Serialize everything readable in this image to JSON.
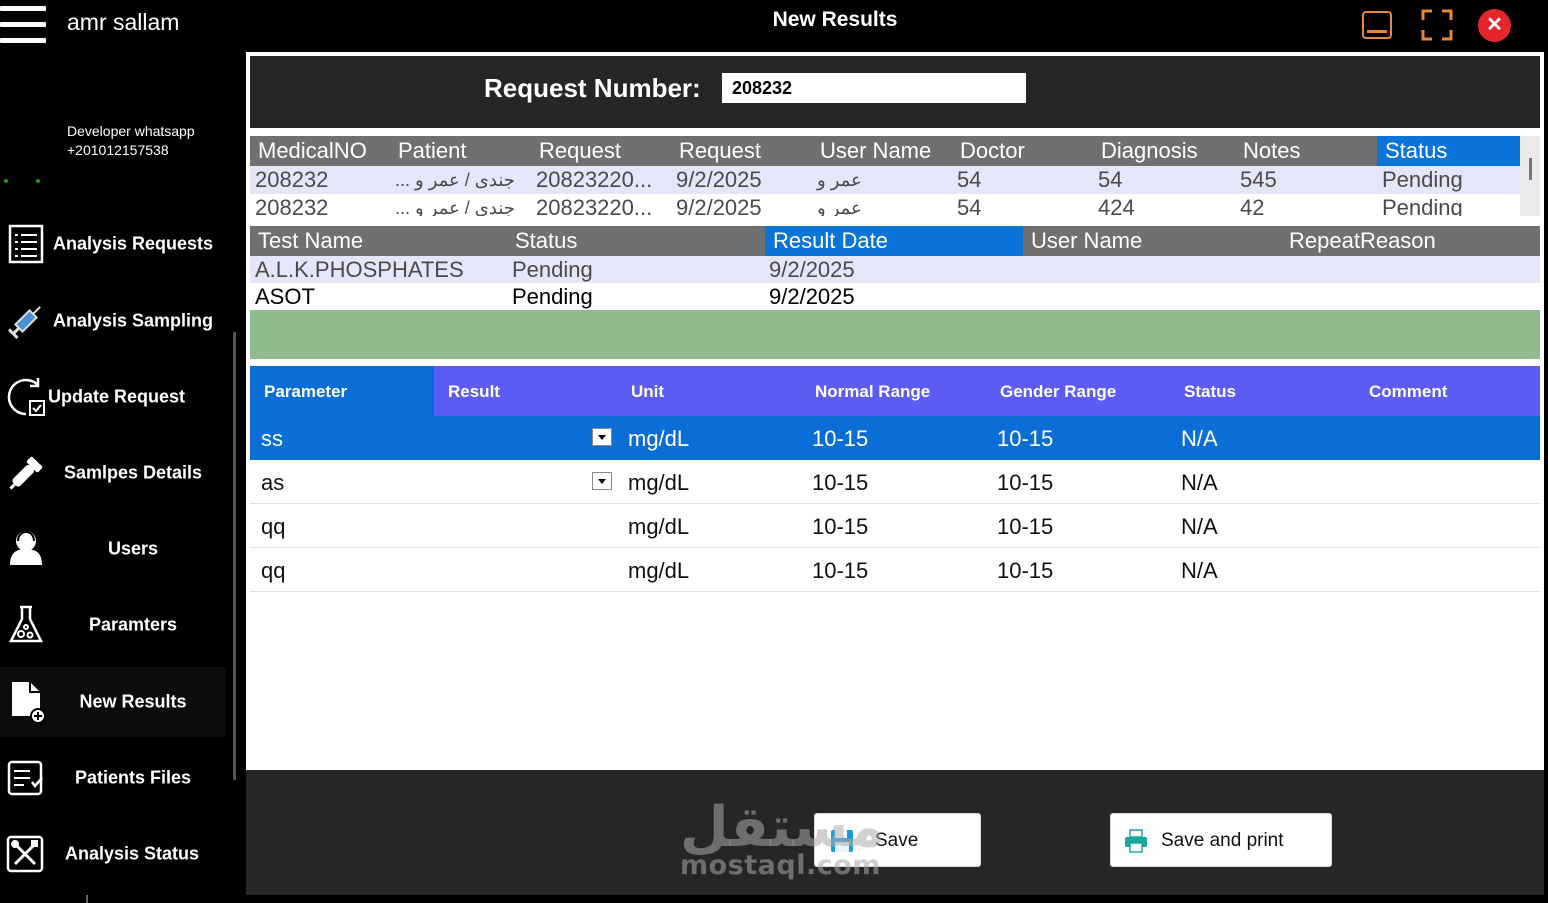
{
  "window": {
    "title": "New Results",
    "user": "amr sallam",
    "close_glyph": "✕"
  },
  "developer": {
    "line1": "Developer whatsapp",
    "line2": "+201012157538"
  },
  "sidebar": {
    "items": [
      {
        "label": "Analysis Requests",
        "icon": "list-icon"
      },
      {
        "label": "Analysis Sampling",
        "icon": "syringe-icon"
      },
      {
        "label": "Update Request",
        "icon": "refresh-check-icon"
      },
      {
        "label": "Samlpes Details",
        "icon": "dropper-icon"
      },
      {
        "label": "Users",
        "icon": "users-icon"
      },
      {
        "label": "Paramters",
        "icon": "flask-icon"
      },
      {
        "label": "New Results",
        "icon": "document-add-icon"
      },
      {
        "label": "Patients Files",
        "icon": "checklist-icon"
      },
      {
        "label": "Analysis Status",
        "icon": "tools-icon"
      }
    ]
  },
  "request": {
    "label": "Request Number:",
    "value": "208232"
  },
  "requests_grid": {
    "columns": [
      "MedicalNO",
      "Patient",
      "Request",
      "Request",
      "User Name",
      "Doctor",
      "Diagnosis",
      "Notes",
      "Status"
    ],
    "rows": [
      [
        "208232",
        "... جندى / عمر و",
        "20823220...",
        "9/2/2025",
        "عمر و",
        "54",
        "54",
        "545",
        "Pending"
      ],
      [
        "208232",
        "... جندى / عمر و",
        "20823220...",
        "9/2/2025",
        "عمر و",
        "54",
        "424",
        "42",
        "Pending"
      ]
    ]
  },
  "tests_grid": {
    "columns": [
      "Test Name",
      "Status",
      "Result Date",
      "User Name",
      "RepeatReason"
    ],
    "rows": [
      [
        "A.L.K.PHOSPHATES",
        "Pending",
        "9/2/2025",
        "",
        ""
      ],
      [
        "ASOT",
        "Pending",
        "9/2/2025",
        "",
        ""
      ]
    ]
  },
  "results_grid": {
    "columns": [
      "Parameter",
      "Result",
      "Unit",
      "Normal Range",
      "Gender Range",
      "Status",
      "Comment"
    ],
    "rows": [
      [
        "ss",
        "",
        "mg/dL",
        "10-15",
        "10-15",
        "N/A",
        ""
      ],
      [
        "as",
        "",
        "mg/dL",
        "10-15",
        "10-15",
        "N/A",
        ""
      ],
      [
        "qq",
        "",
        "mg/dL",
        "10-15",
        "10-15",
        "N/A",
        ""
      ],
      [
        "qq",
        "",
        "mg/dL",
        "10-15",
        "10-15",
        "N/A",
        ""
      ]
    ]
  },
  "actions": {
    "save": "Save",
    "save_print": "Save and print"
  },
  "watermark": {
    "arabic": "مستقل",
    "latin": "mostaql.com"
  },
  "colors": {
    "selected_blue": "#0a6ed6",
    "results_header": "#5c5cf5",
    "green_bar": "#8fbc8f",
    "close_red": "#e6262d",
    "minimize_orange": "#e8873a"
  }
}
